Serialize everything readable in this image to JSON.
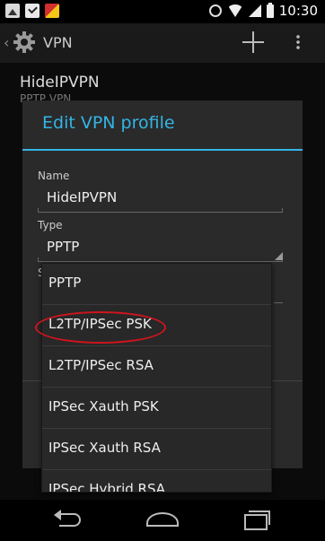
{
  "status_bar": {
    "time": "10:30"
  },
  "action_bar": {
    "title": "VPN"
  },
  "background_list": {
    "item_title": "HideIPVPN",
    "item_subtitle": "PPTP VPN"
  },
  "dialog": {
    "title": "Edit VPN profile",
    "name_label": "Name",
    "name_value": "HideIPVPN",
    "type_label": "Type",
    "type_value": "PPTP",
    "partial_label": "S"
  },
  "dropdown": {
    "options": [
      "PPTP",
      "L2TP/IPSec PSK",
      "L2TP/IPSec RSA",
      "IPSec Xauth PSK",
      "IPSec Xauth RSA",
      "IPSec Hybrid RSA"
    ],
    "highlighted_option": "L2TP/IPSec PSK"
  },
  "colors": {
    "accent": "#33b5e5",
    "highlight_ring": "#d0141e",
    "dialog_bg": "#2a2a2a"
  }
}
